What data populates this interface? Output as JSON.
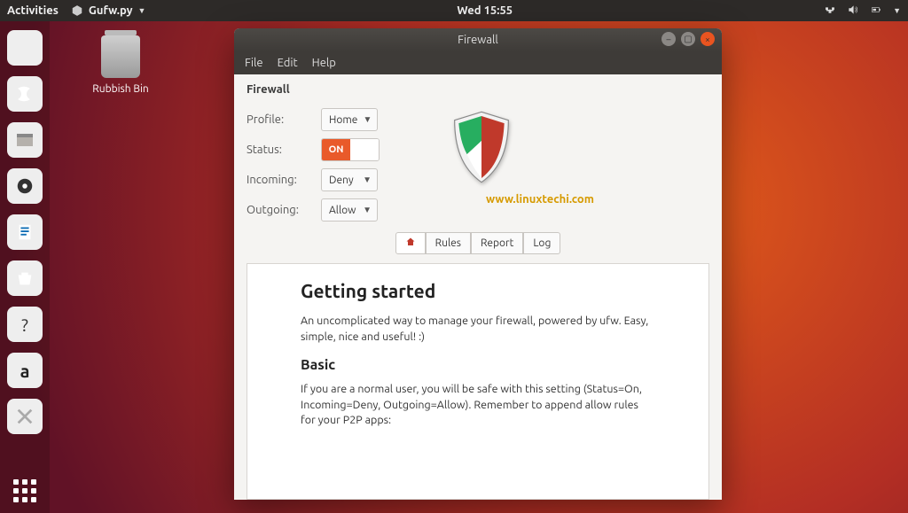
{
  "topbar": {
    "activities": "Activities",
    "app_name": "Gufw.py",
    "clock": "Wed 15:55"
  },
  "desktop": {
    "trash_label": "Rubbish Bin"
  },
  "window": {
    "title": "Firewall",
    "menu": {
      "file": "File",
      "edit": "Edit",
      "help": "Help"
    },
    "section": "Firewall",
    "labels": {
      "profile": "Profile:",
      "status": "Status:",
      "incoming": "Incoming:",
      "outgoing": "Outgoing:"
    },
    "values": {
      "profile": "Home",
      "status_on": "ON",
      "incoming": "Deny",
      "outgoing": "Allow"
    },
    "tabs": {
      "rules": "Rules",
      "report": "Report",
      "log": "Log"
    },
    "content": {
      "h1": "Getting started",
      "p1": "An uncomplicated way to manage your firewall, powered by ufw. Easy, simple, nice and useful! :)",
      "h2": "Basic",
      "p2": "If you are a normal user, you will be safe with this setting (Status=On, Incoming=Deny, Outgoing=Allow). Remember to append allow rules for your P2P apps:"
    },
    "watermark": "www.linuxtechi.com"
  },
  "dock": {
    "amazon_letter": "a"
  }
}
